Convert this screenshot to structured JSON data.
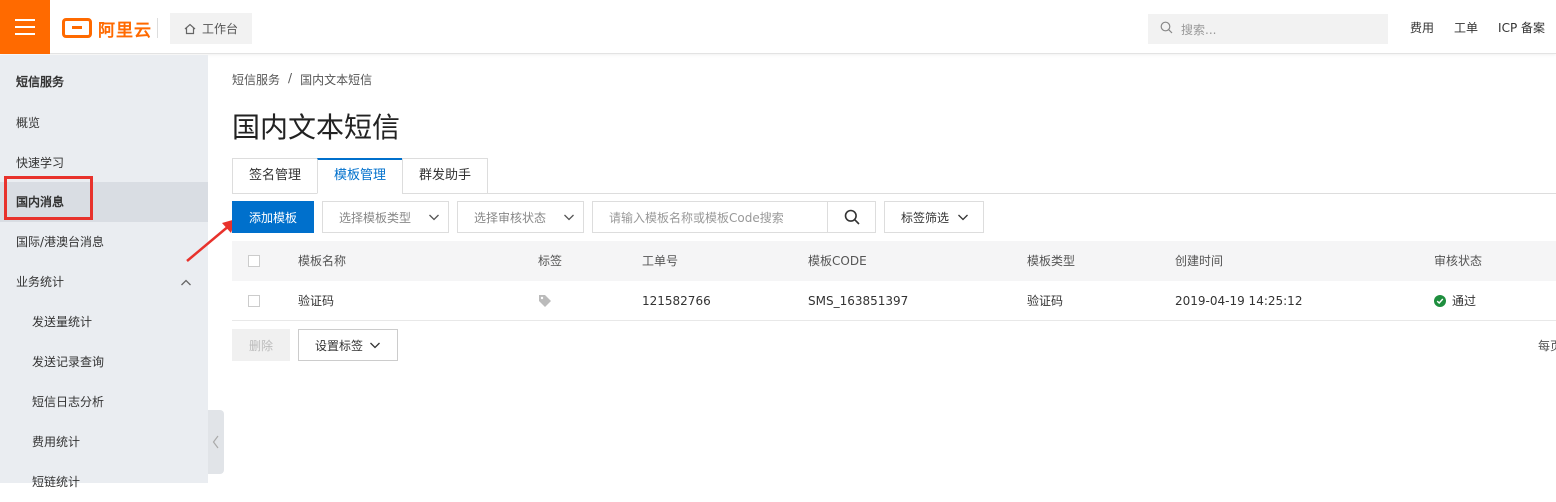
{
  "topbar": {
    "logo_text": "阿里云",
    "workbench_label": "工作台",
    "search_placeholder": "搜索...",
    "links": [
      "费用",
      "工单",
      "ICP 备案"
    ]
  },
  "sidebar": {
    "title": "短信服务",
    "items": [
      {
        "label": "概览"
      },
      {
        "label": "快速学习"
      },
      {
        "label": "国内消息"
      },
      {
        "label": "国际/港澳台消息"
      },
      {
        "label": "业务统计"
      },
      {
        "label": "发送量统计"
      },
      {
        "label": "发送记录查询"
      },
      {
        "label": "短信日志分析"
      },
      {
        "label": "费用统计"
      },
      {
        "label": "短链统计"
      }
    ]
  },
  "breadcrumb": {
    "root": "短信服务",
    "separator": "/",
    "current": "国内文本短信"
  },
  "page_title": "国内文本短信",
  "tabs": [
    {
      "label": "签名管理"
    },
    {
      "label": "模板管理"
    },
    {
      "label": "群发助手"
    }
  ],
  "toolbar": {
    "add_label": "添加模板",
    "type_select_placeholder": "选择模板类型",
    "status_select_placeholder": "选择审核状态",
    "search_placeholder": "请输入模板名称或模板Code搜索",
    "filter_label": "标签筛选"
  },
  "table": {
    "columns": [
      "模板名称",
      "标签",
      "工单号",
      "模板CODE",
      "模板类型",
      "创建时间",
      "审核状态"
    ],
    "rows": [
      {
        "name": "验证码",
        "order_no": "121582766",
        "code": "SMS_163851397",
        "type": "验证码",
        "created": "2019-04-19 14:25:12",
        "status": "通过"
      }
    ]
  },
  "bottom": {
    "delete_label": "删除",
    "set_tag_label": "设置标签",
    "per_page_label": "每页"
  },
  "colors": {
    "brand": "#ff6a00",
    "primary": "#0070cc",
    "success": "#1e8e3e",
    "annotation": "#e8322c"
  }
}
